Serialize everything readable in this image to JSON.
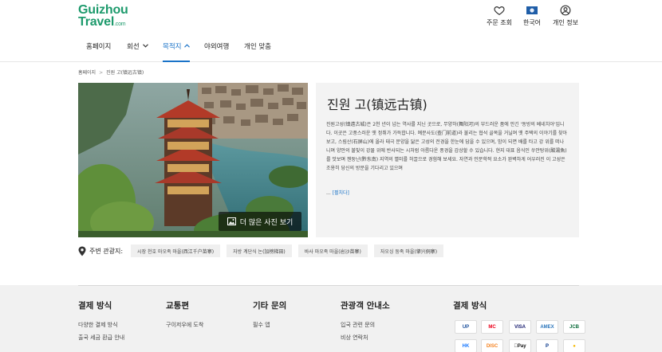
{
  "brand": {
    "logo_line1": "Guizhou",
    "logo_line2": "Travel",
    "logo_suffix": ".com",
    "color": "#1d9a6c"
  },
  "top_actions": [
    {
      "label": "주문 조회",
      "icon": "heart-icon"
    },
    {
      "label": "한국어",
      "icon": "flag-icon"
    },
    {
      "label": "개인 정보",
      "icon": "user-icon"
    }
  ],
  "nav": [
    {
      "label": "홈페이지"
    },
    {
      "label": "회선"
    },
    {
      "label": "목적지"
    },
    {
      "label": "야외여행"
    },
    {
      "label": "개인 맞춤"
    }
  ],
  "breadcrumb": {
    "home": "홈페이지",
    "separator": ">",
    "current": "진원 고(镇远古镇)"
  },
  "hero": {
    "more_photos_label": "더 많은 사진 보기"
  },
  "info": {
    "title": "진원 고(镇远古镇)",
    "description": "진원고성(镇遠古城)은 2천 년이 넘는 역사를 지닌 곳으로, 무양하(舞阳河)의 부드러운 품에 안긴 '동방의 베네치아'입니다. 이곳은 고풍스러운 옛 정취가 가득합니다. 예문사도(查门前道)라 불리는 협석 골목을 거닐며 옛 주택의 이야기를 찾아보고, 스림산(石屏山)에 올라 태극 문양을 닮은 고성의 전경을 한눈에 담을 수 있으며, 밤이 되면 배를 타고 강 위를 떠나니며 양안의 불빛이 강물 위에 반사되는 시처럼 아름다운 풍경을 감상할 수 있습니다. 현지 대표 음식인 쑤안탕위(酸湯魚)를 맛보며 첸둥난(黔东南) 지역의 별미를 허끌으로 경험해 보세요. 자연과 인문학적 요소가 완벽하게 어우러진 이 고성은 조용히 당신의 방문을 기다리고 있으며",
    "ellipsis": "...",
    "expand_label": "[펼치다]"
  },
  "nearby": {
    "label": "주변 관광지:",
    "tags": [
      "시장 천호 마오족 마을(西江千户苗寨)",
      "자방 계단식 논(加榜梯田)",
      "바사 마오족 마을(岜沙苗寨)",
      "자오싱 둥족 마을(肇兴侗寨)"
    ]
  },
  "footer": {
    "columns": [
      {
        "title": "결제 방식",
        "links": [
          "다양한 결제 방식",
          "출국 세금 환급 안내"
        ]
      },
      {
        "title": "교통편",
        "links": [
          "구이저우에 도착"
        ]
      },
      {
        "title": "기타 문의",
        "links": [
          "필수 앱"
        ]
      },
      {
        "title": "관광객 안내소",
        "links": [
          "입국 관련 문의",
          "비상 연락처"
        ]
      },
      {
        "title": "결제 방식",
        "links": []
      }
    ],
    "payments": [
      {
        "name": "UnionPay",
        "text": "UP",
        "color": "#1b4f9c"
      },
      {
        "name": "Mastercard",
        "text": "MC",
        "color": "#eb001b"
      },
      {
        "name": "Visa",
        "text": "VISA",
        "color": "#1a1f71"
      },
      {
        "name": "American Express",
        "text": "AMEX",
        "color": "#2e77bc"
      },
      {
        "name": "JCB",
        "text": "JCB",
        "color": "#0b6b3a"
      },
      {
        "name": "Alipay HK",
        "text": "HK",
        "color": "#1677ff"
      },
      {
        "name": "Discover",
        "text": "DISC",
        "color": "#f58220"
      },
      {
        "name": "Apple Pay",
        "text": "Pay",
        "color": "#111111"
      },
      {
        "name": "PayPal",
        "text": "P",
        "color": "#003087"
      },
      {
        "name": "Coin",
        "text": "●",
        "color": "#f5b800"
      }
    ]
  },
  "colors": {
    "accent": "#1a73c8",
    "footer_bg": "#f1f1f1",
    "panel_bg": "#f3f3f3"
  }
}
